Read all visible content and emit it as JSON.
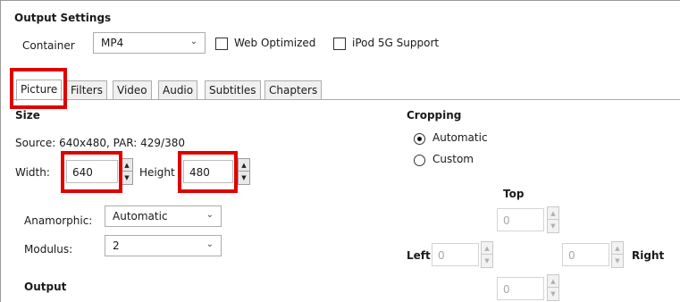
{
  "output_settings": {
    "title": "Output Settings",
    "container_label": "Container",
    "container_value": "MP4",
    "web_optimized_label": "Web Optimized",
    "web_optimized_checked": false,
    "ipod_label": "iPod 5G Support",
    "ipod_checked": false
  },
  "tabs": [
    {
      "label": "Picture",
      "active": true
    },
    {
      "label": "Filters",
      "active": false
    },
    {
      "label": "Video",
      "active": false
    },
    {
      "label": "Audio",
      "active": false
    },
    {
      "label": "Subtitles",
      "active": false
    },
    {
      "label": "Chapters",
      "active": false
    }
  ],
  "size": {
    "heading": "Size",
    "source_text": "Source:   640x480, PAR: 429/380",
    "width_label": "Width:",
    "width_value": "640",
    "height_label": "Height",
    "height_value": "480",
    "anamorphic_label": "Anamorphic:",
    "anamorphic_value": "Automatic",
    "modulus_label": "Modulus:",
    "modulus_value": "2"
  },
  "output_heading": "Output",
  "cropping": {
    "heading": "Cropping",
    "automatic_label": "Automatic",
    "custom_label": "Custom",
    "selected": "Automatic",
    "top_label": "Top",
    "left_label": "Left",
    "right_label": "Right",
    "top_value": "0",
    "left_value": "0",
    "right_value": "0",
    "bottom_value": "0"
  },
  "highlight_color": "#e00000",
  "icons": {
    "dropdown": "chevron-down-icon",
    "spin_up": "up-arrow-icon",
    "spin_down": "down-arrow-icon"
  }
}
